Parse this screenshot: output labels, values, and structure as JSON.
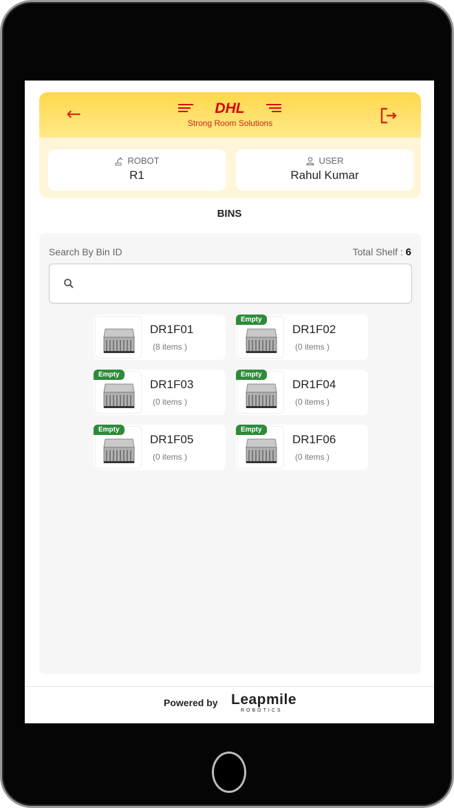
{
  "header": {
    "logo_text": "DHL",
    "subtitle": "Strong Room Solutions",
    "back_icon": "arrow-left-icon",
    "logout_icon": "logout-icon"
  },
  "robot": {
    "label": "ROBOT",
    "value": "R1"
  },
  "user": {
    "label": "USER",
    "value": "Rahul Kumar"
  },
  "page_title": "BINS",
  "search": {
    "label": "Search By Bin ID",
    "placeholder": "",
    "value": ""
  },
  "total_shelf": {
    "label": "Total Shelf :",
    "value": "6"
  },
  "bins": [
    {
      "id": "DR1F01",
      "count": "(8 items )",
      "badge": ""
    },
    {
      "id": "DR1F02",
      "count": "(0 items )",
      "badge": "Empty"
    },
    {
      "id": "DR1F03",
      "count": "(0 items )",
      "badge": "Empty"
    },
    {
      "id": "DR1F04",
      "count": "(0 items )",
      "badge": "Empty"
    },
    {
      "id": "DR1F05",
      "count": "(0 items )",
      "badge": "Empty"
    },
    {
      "id": "DR1F06",
      "count": "(0 items )",
      "badge": "Empty"
    }
  ],
  "footer": {
    "powered_by": "Powered by",
    "brand": "Leapmile",
    "brand_sub": "ROBOTICS"
  },
  "colors": {
    "accent": "#ffcc00",
    "brand_red": "#d40511",
    "badge_green": "#2e8b3a"
  }
}
